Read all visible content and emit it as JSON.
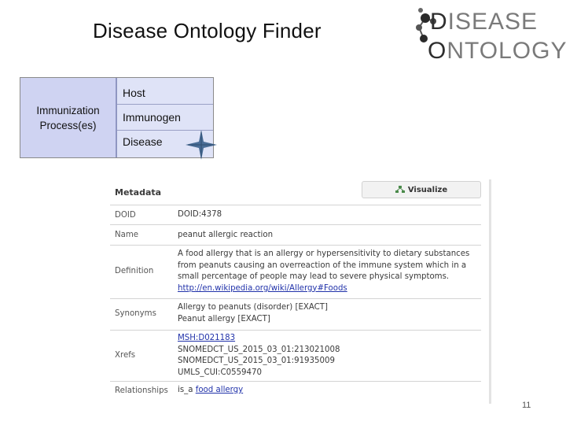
{
  "slide": {
    "title": "Disease Ontology Finder",
    "page_number": "11"
  },
  "logo": {
    "line1_first": "D",
    "line1_rest": "ISEASE",
    "line2_first": "O",
    "line2_rest": "NTOLOGY",
    "colors": {
      "dark": "#2e2e2e",
      "gray": "#7a7a7a",
      "accent_dot": "#2a2a2a"
    }
  },
  "immunization": {
    "label": "Immunization Process(es)",
    "items": [
      "Host",
      "Immunogen",
      "Disease"
    ],
    "colors": {
      "left_bg": "#cfd3f2",
      "right_bg": "#dfe3f7",
      "cross": "#4a6d96"
    }
  },
  "metadata": {
    "heading": "Metadata",
    "visualize_label": "Visualize",
    "rows": [
      {
        "key": "DOID",
        "lines": [
          "DOID:4378"
        ]
      },
      {
        "key": "Name",
        "lines": [
          "peanut allergic reaction"
        ]
      },
      {
        "key": "Definition",
        "lines": [
          "A food allergy that is an allergy or hypersensitivity to dietary substances",
          "from peanuts causing an overreaction of the immune system which in a",
          "small percentage of people may lead to severe physical symptoms."
        ],
        "link": "http://en.wikipedia.org/wiki/Allergy#Foods"
      },
      {
        "key": "Synonyms",
        "lines": [
          "Allergy to peanuts (disorder) [EXACT]",
          "Peanut allergy [EXACT]"
        ]
      },
      {
        "key": "Xrefs",
        "links": [
          "MSH:D021183"
        ],
        "lines": [
          "SNOMEDCT_US_2015_03_01:213021008",
          "SNOMEDCT_US_2015_03_01:91935009",
          "UMLS_CUI:C0559470"
        ]
      },
      {
        "key": "Relationships",
        "prefix": "is_a",
        "link": "food allergy"
      }
    ]
  }
}
